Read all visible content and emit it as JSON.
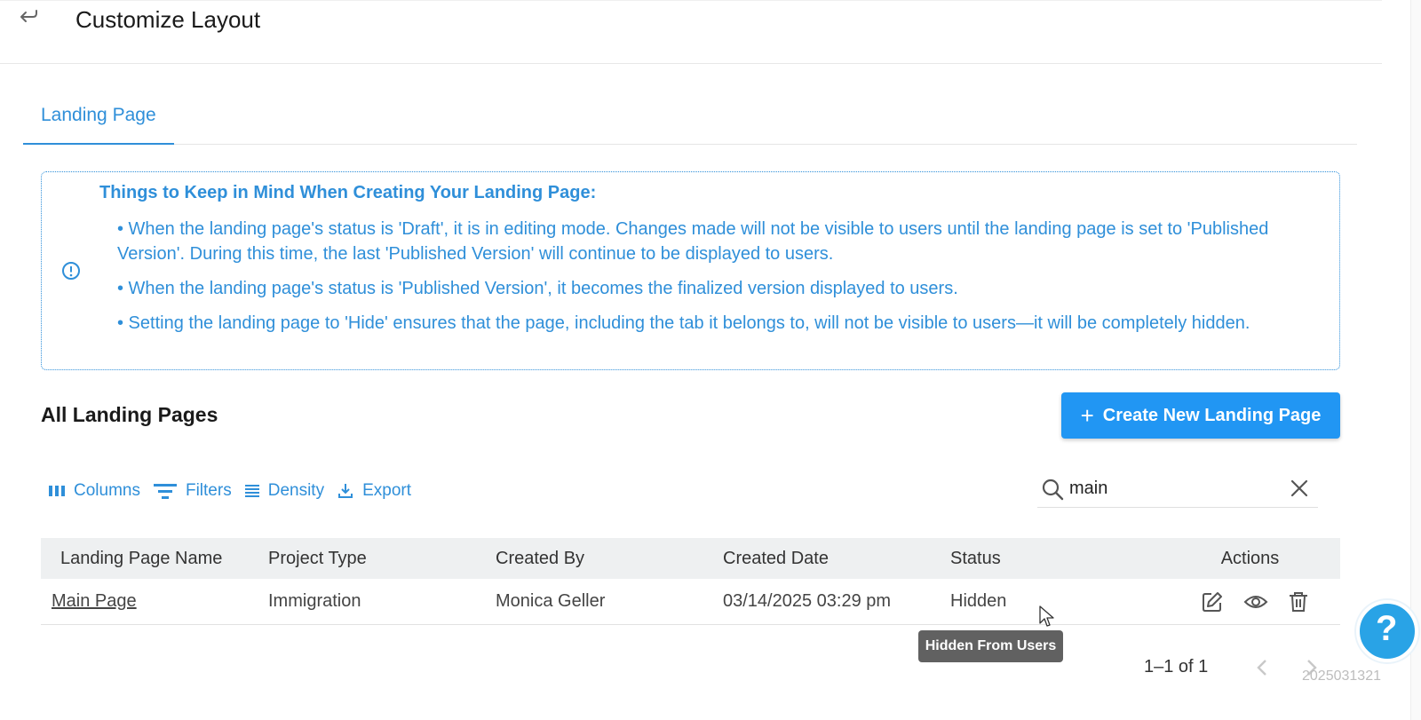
{
  "header": {
    "title": "Customize Layout"
  },
  "tabs": [
    {
      "label": "Landing Page"
    }
  ],
  "notice": {
    "title": "Things to Keep in Mind When Creating Your Landing Page:",
    "items": [
      "• When the landing page's status is 'Draft', it is in editing mode. Changes made will not be visible to users until the landing page is set to 'Published Version'. During this time, the last 'Published Version' will continue to be displayed to users.",
      "• When the landing page's status is 'Published Version', it becomes the finalized version displayed to users.",
      "• Setting the landing page to 'Hide' ensures that the page, including the tab it belongs to, will not be visible to users—it will be completely hidden."
    ]
  },
  "section": {
    "title": "All Landing Pages",
    "create_label": "Create New Landing Page"
  },
  "toolbar": {
    "columns": "Columns",
    "filters": "Filters",
    "density": "Density",
    "export": "Export"
  },
  "search": {
    "value": "main"
  },
  "table": {
    "headers": [
      "Landing Page Name",
      "Project Type",
      "Created By",
      "Created Date",
      "Status",
      "Actions"
    ],
    "rows": [
      {
        "name": "Main Page",
        "project_type": "Immigration",
        "created_by": "Monica Geller",
        "created_date": "03/14/2025 03:29 pm",
        "status": "Hidden"
      }
    ]
  },
  "tooltip": "Hidden From Users",
  "pagination": {
    "range": "1–1 of 1"
  },
  "help": {
    "symbol": "?"
  },
  "watermark": "2025031321",
  "colors": {
    "accent": "#2196f3",
    "link": "#2f8fd9",
    "tooltip_bg": "#616161",
    "header_bg": "#eef0f1"
  },
  "icons": [
    "back-icon",
    "info-icon",
    "columns-icon",
    "filter-icon",
    "density-icon",
    "export-icon",
    "search-icon",
    "close-icon",
    "edit-icon",
    "eye-icon",
    "trash-icon",
    "chevron-left-icon",
    "chevron-right-icon",
    "cursor-icon"
  ]
}
